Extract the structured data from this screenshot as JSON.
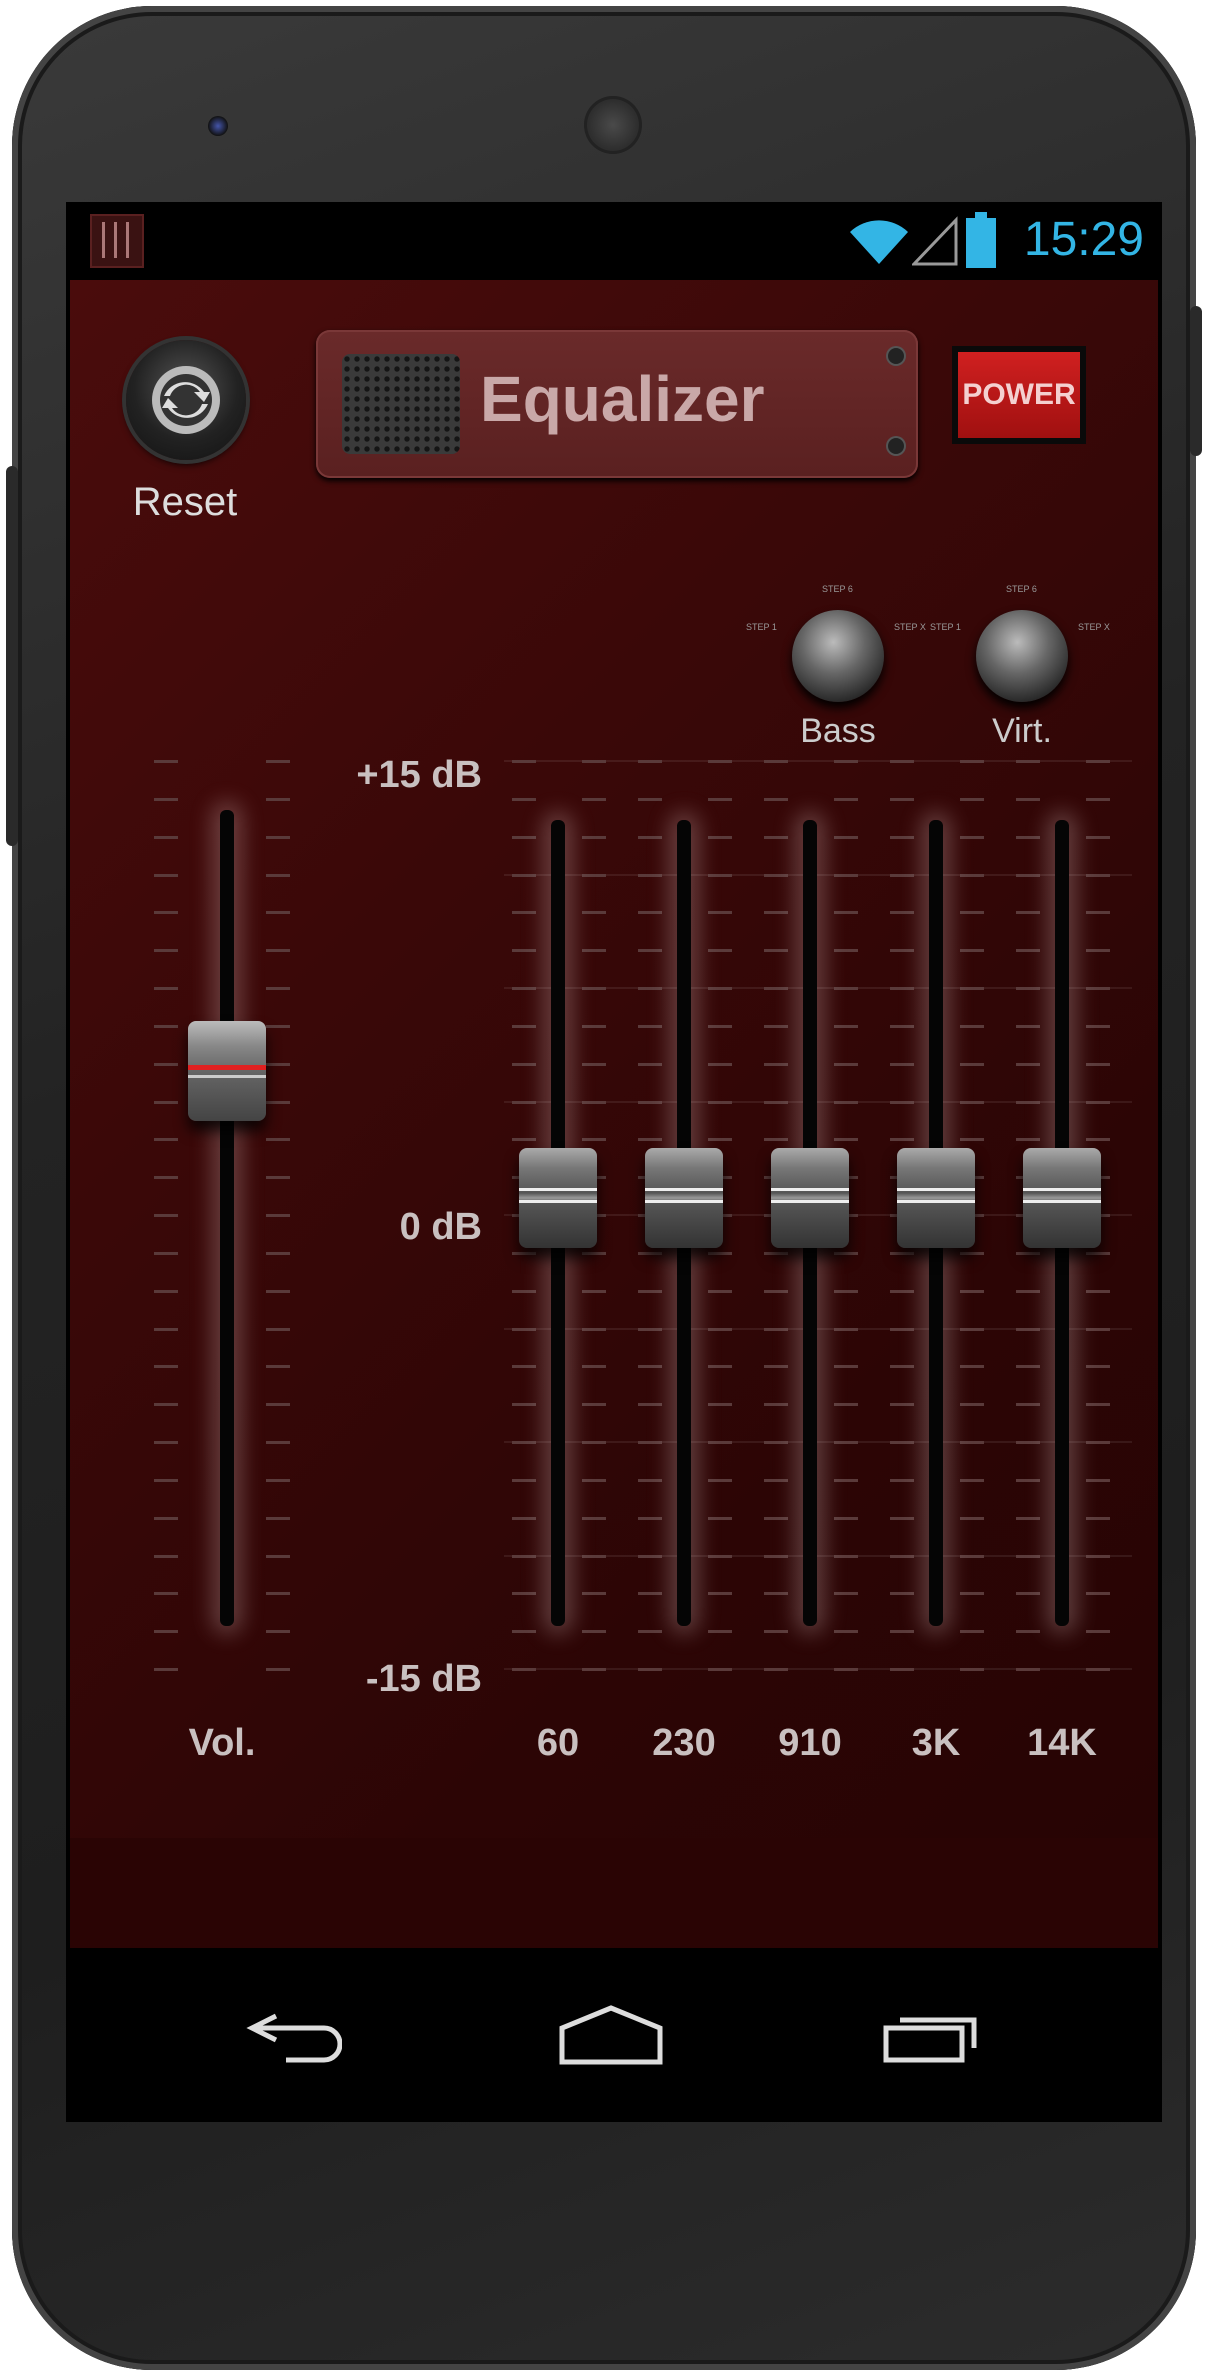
{
  "status_bar": {
    "time": "15:29",
    "icons": [
      "app-equalizer-icon",
      "wifi-icon",
      "signal-icon",
      "battery-icon"
    ]
  },
  "header": {
    "reset_label": "Reset",
    "title": "Equalizer",
    "power_label": "POWER"
  },
  "knobs": [
    {
      "label": "Bass",
      "steps": [
        "STEP 1",
        "STEP 6",
        "STEP X"
      ]
    },
    {
      "label": "Virt.",
      "steps": [
        "STEP 1",
        "STEP 6",
        "STEP X"
      ]
    }
  ],
  "scale": {
    "top": "+15 dB",
    "mid": "0 dB",
    "bottom": "-15 dB"
  },
  "volume": {
    "label": "Vol.",
    "level": 0.68
  },
  "bands": [
    {
      "label": "60",
      "gain_db": 0
    },
    {
      "label": "230",
      "gain_db": 0
    },
    {
      "label": "910",
      "gain_db": 0
    },
    {
      "label": "3K",
      "gain_db": 0
    },
    {
      "label": "14K",
      "gain_db": 0
    }
  ],
  "colors": {
    "accent": "#33b5e5",
    "power": "#c01818",
    "background": "#3a0808"
  },
  "nav_icons": [
    "back-icon",
    "home-icon",
    "recent-apps-icon"
  ]
}
